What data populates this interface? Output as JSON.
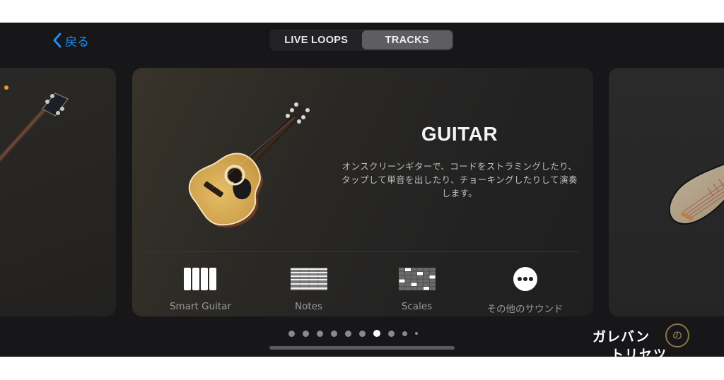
{
  "nav": {
    "back_label": "戻る",
    "tabs": [
      {
        "label": "LIVE LOOPS",
        "active": false
      },
      {
        "label": "TRACKS",
        "active": true
      }
    ]
  },
  "instrument": {
    "title": "GUITAR",
    "description": "オンスクリーンギターで、コードをストラミングしたり、タップして単音を出したり、チョーキングしたりして演奏します。",
    "modes": [
      {
        "label": "Smart Guitar",
        "icon": "smart-guitar-icon"
      },
      {
        "label": "Notes",
        "icon": "notes-icon"
      },
      {
        "label": "Scales",
        "icon": "scales-icon"
      },
      {
        "label": "その他のサウンド",
        "icon": "more-icon"
      }
    ]
  },
  "pagination": {
    "total": 10,
    "current": 7
  },
  "colors": {
    "accent": "#1e8ef5",
    "indicator": "#f59a23"
  },
  "watermark": {
    "line1": "ガレバン",
    "line2": "トリセツ",
    "bubble": "の"
  }
}
